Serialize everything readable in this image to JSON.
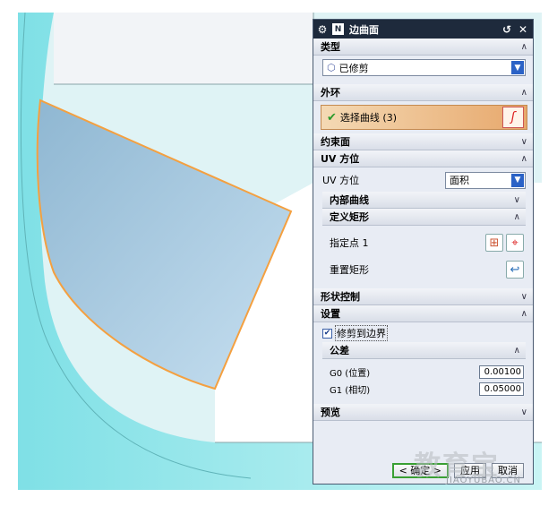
{
  "dialog": {
    "title": "边曲面",
    "title_icon": "N",
    "sections": {
      "type": {
        "label": "类型",
        "combo_value": "已修剪"
      },
      "outer_loop": {
        "label": "外环",
        "select_label": "选择曲线 (3)"
      },
      "constraint_face": {
        "label": "约束面"
      },
      "uv_orientation": {
        "label": "UV 方位",
        "field_label": "UV 方位",
        "field_value": "面积",
        "inner_curves": "内部曲线",
        "define_rect": "定义矩形",
        "specify_point": "指定点 1",
        "reset_rect": "重置矩形"
      },
      "shape_control": {
        "label": "形状控制"
      },
      "settings": {
        "label": "设置",
        "trim_to_boundary": "修剪到边界",
        "tolerance": {
          "label": "公差",
          "g0_label": "G0 (位置)",
          "g0_value": "0.00100",
          "g1_label": "G1 (相切)",
          "g1_value": "0.05000"
        }
      },
      "preview": {
        "label": "预览"
      }
    },
    "buttons": {
      "ok": "< 确定 >",
      "apply": "应用",
      "cancel": "取消"
    }
  },
  "watermark": {
    "text": "教育宝",
    "url": "JIAOYUBAO.CN"
  },
  "colors": {
    "surface_fill": "#a9cbe0",
    "boundary_curve": "#f4a040",
    "title_bar": "#1e2a3c",
    "selection_row": "#e7a86c"
  }
}
